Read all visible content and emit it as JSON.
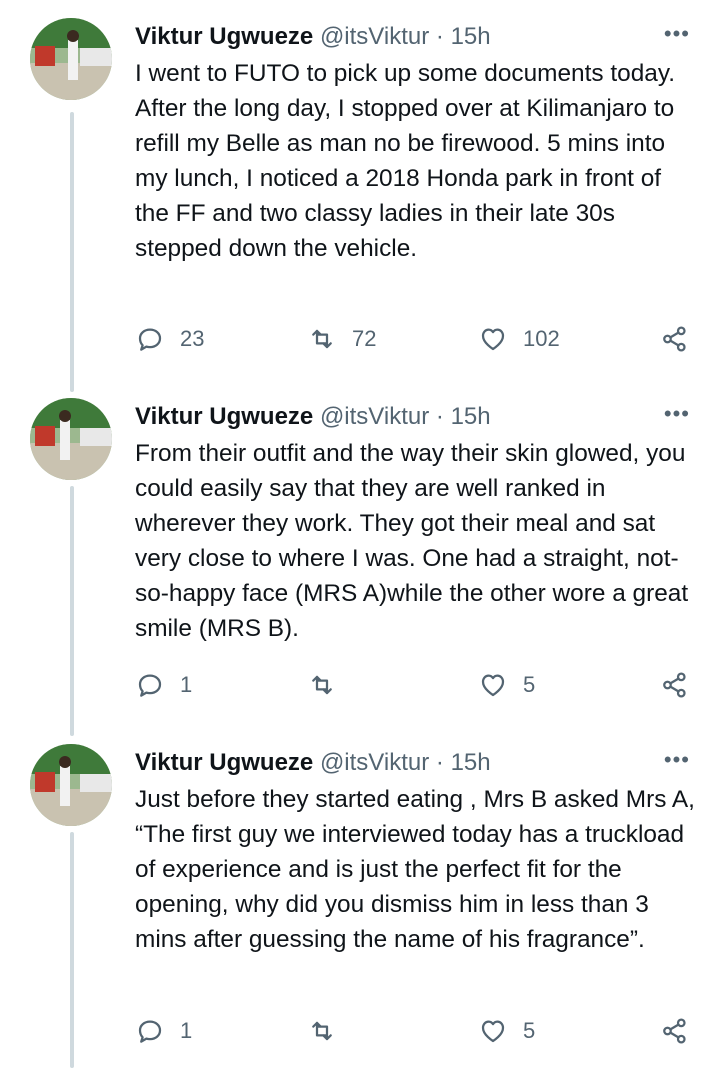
{
  "tweets": [
    {
      "name": "Viktur Ugwueze",
      "handle": "@itsViktur",
      "dot": "·",
      "time": "15h",
      "more": "•••",
      "text": "I went to FUTO to pick up some documents today. After the long day, I stopped over at Kilimanjaro to refill my Belle as man no be firewood. 5 mins into my lunch, I noticed a 2018 Honda park in front of the FF and two classy ladies in their late 30s stepped down the vehicle.",
      "replies": "23",
      "retweets": "72",
      "likes": "102"
    },
    {
      "name": "Viktur Ugwueze",
      "handle": "@itsViktur",
      "dot": "·",
      "time": "15h",
      "more": "•••",
      "text": "From their outfit and the way their skin glowed, you could easily say that they are well ranked in wherever they work. They got their meal and sat very close to where I was. One had a straight, not-so-happy face (MRS A)while the other wore a great smile (MRS B).",
      "replies": "1",
      "retweets": "",
      "likes": "5"
    },
    {
      "name": "Viktur Ugwueze",
      "handle": "@itsViktur",
      "dot": "·",
      "time": "15h",
      "more": "•••",
      "text": "Just before they started eating , Mrs B asked Mrs A, “The first guy we interviewed today has a truckload of experience and is just the perfect fit for the opening, why did you dismiss him in less than 3 mins after guessing the name of his fragrance”.",
      "replies": "1",
      "retweets": "",
      "likes": "5"
    }
  ],
  "icons": {
    "reply": "reply-icon",
    "retweet": "retweet-icon",
    "like": "heart-icon",
    "share": "share-icon"
  },
  "colors": {
    "text": "#0f1419",
    "secondary": "#536471",
    "thread_line": "#cfd9de"
  }
}
